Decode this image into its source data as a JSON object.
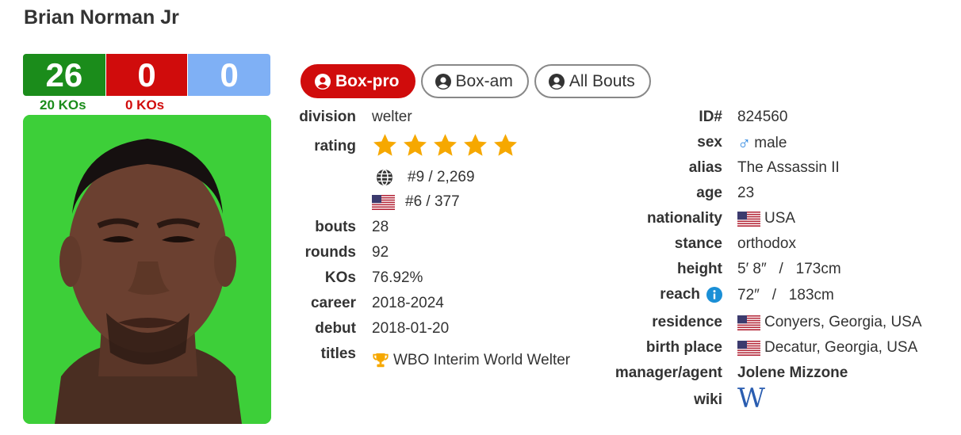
{
  "boxer_name": "Brian Norman Jr",
  "record": {
    "wins": "26",
    "losses": "0",
    "draws": "0",
    "win_kos": "20 KOs",
    "loss_kos": "0 KOs"
  },
  "tabs": [
    {
      "label": "Box-pro",
      "active": true
    },
    {
      "label": "Box-am",
      "active": false
    },
    {
      "label": "All Bouts",
      "active": false
    }
  ],
  "left_details": {
    "division_label": "division",
    "division": "welter",
    "rating_label": "rating",
    "rating_stars": 5,
    "world_rank": "#9 / 2,269",
    "country_rank": "#6 / 377",
    "bouts_label": "bouts",
    "bouts": "28",
    "rounds_label": "rounds",
    "rounds": "92",
    "kos_label": "KOs",
    "kos": "76.92%",
    "career_label": "career",
    "career": "2018-2024",
    "debut_label": "debut",
    "debut": "2018-01-20",
    "titles_label": "titles",
    "title": "WBO Interim World Welter"
  },
  "right_details": {
    "id_label": "ID#",
    "id": "824560",
    "sex_label": "sex",
    "sex": "male",
    "alias_label": "alias",
    "alias": "The Assassin II",
    "age_label": "age",
    "age": "23",
    "nationality_label": "nationality",
    "nationality": "USA",
    "stance_label": "stance",
    "stance": "orthodox",
    "height_label": "height",
    "height": "5′ 8″   /   173cm",
    "reach_label": "reach",
    "reach": "72″   /   183cm",
    "residence_label": "residence",
    "residence": "Conyers, Georgia, USA",
    "birth_place_label": "birth place",
    "birth_place": "Decatur, Georgia, USA",
    "manager_label": "manager/agent",
    "manager": "Jolene Mizzone",
    "wiki_label": "wiki",
    "wiki_glyph": "W"
  },
  "colors": {
    "win": "#1b8c1b",
    "loss": "#d00c0c",
    "draw": "#7fb0f5",
    "star": "#f6a800"
  },
  "icons": [
    "user-circle-icon",
    "globe-icon",
    "us-flag-icon",
    "male-icon",
    "info-icon",
    "trophy-icon",
    "wikipedia-icon",
    "star-icon"
  ]
}
